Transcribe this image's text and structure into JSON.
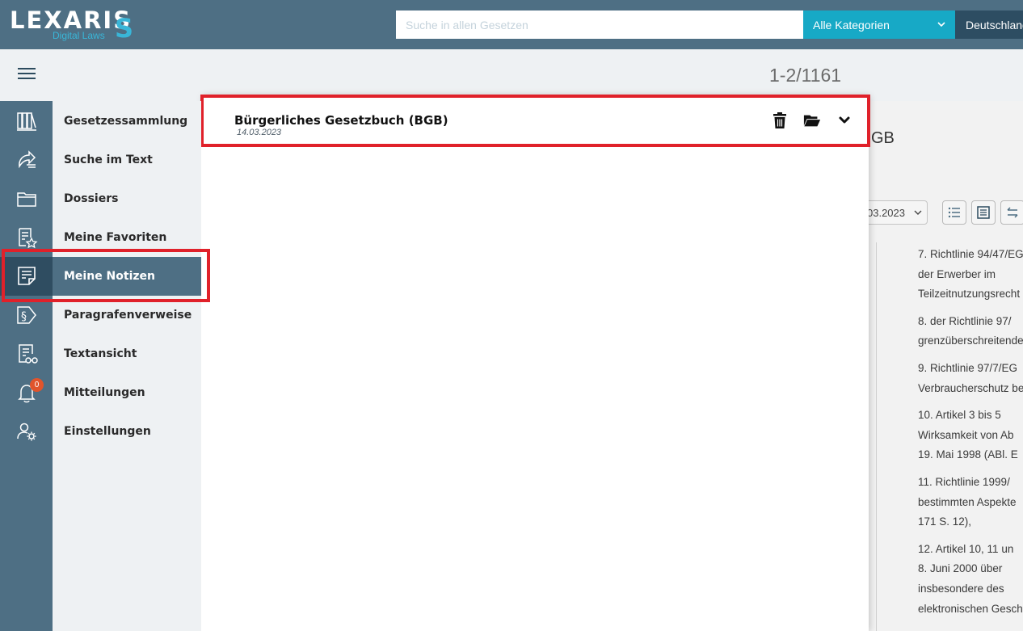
{
  "app": {
    "logo_text": "LEXARIS",
    "logo_subtext": "Digital Laws",
    "logo_mark": "S"
  },
  "header": {
    "search_placeholder": "Suche in allen Gesetzen",
    "category_label": "Alle Kategorien",
    "country_label": "Deutschland"
  },
  "results": {
    "count_text": "1-2/1161"
  },
  "rail": {
    "items": [
      {
        "icon": "law-books-icon"
      },
      {
        "icon": "text-search-icon"
      },
      {
        "icon": "folder-icon"
      },
      {
        "icon": "favorites-doc-star-icon"
      },
      {
        "icon": "notes-icon"
      },
      {
        "icon": "paragraph-references-icon"
      },
      {
        "icon": "text-view-glasses-icon"
      },
      {
        "icon": "bell-icon"
      },
      {
        "icon": "user-settings-icon"
      }
    ],
    "notification_count": "0"
  },
  "nav": {
    "items": [
      {
        "label": "Gesetzessammlung"
      },
      {
        "label": "Suche im Text"
      },
      {
        "label": "Dossiers"
      },
      {
        "label": "Meine Favoriten"
      },
      {
        "label": "Meine Notizen",
        "active": true
      },
      {
        "label": "Paragrafenverweise"
      },
      {
        "label": "Textansicht"
      },
      {
        "label": "Mitteilungen"
      },
      {
        "label": "Einstellungen"
      }
    ]
  },
  "note": {
    "title": "Bürgerliches Gesetzbuch (BGB)",
    "date": "14.03.2023",
    "actions": [
      "trash-icon",
      "folder-open-icon",
      "chevron-down-icon"
    ]
  },
  "document": {
    "title_fragment": "GB",
    "date_value": "03.2023",
    "paragraphs": [
      [
        "7. Richtlinie 94/47/EG",
        "der Erwerber im",
        "Teilzeitnutzungsrecht"
      ],
      [
        "8. der Richtlinie 97/",
        "grenzüberschreitende"
      ],
      [
        "9. Richtlinie 97/7/EG",
        "Verbraucherschutz be"
      ],
      [
        "10. Artikel 3 bis 5",
        "Wirksamkeit von Ab",
        "19. Mai 1998 (ABl. E"
      ],
      [
        "11. Richtlinie 1999/",
        "bestimmten Aspekte",
        "171 S. 12),"
      ],
      [
        "12. Artikel 10, 11 un",
        "8. Juni 2000 über",
        "insbesondere des",
        "elektronischen Gesch"
      ]
    ]
  },
  "colors": {
    "header_bg": "#4e6f84",
    "accent": "#17a9c6",
    "highlight": "#e0212a",
    "badge": "#e0542c"
  }
}
